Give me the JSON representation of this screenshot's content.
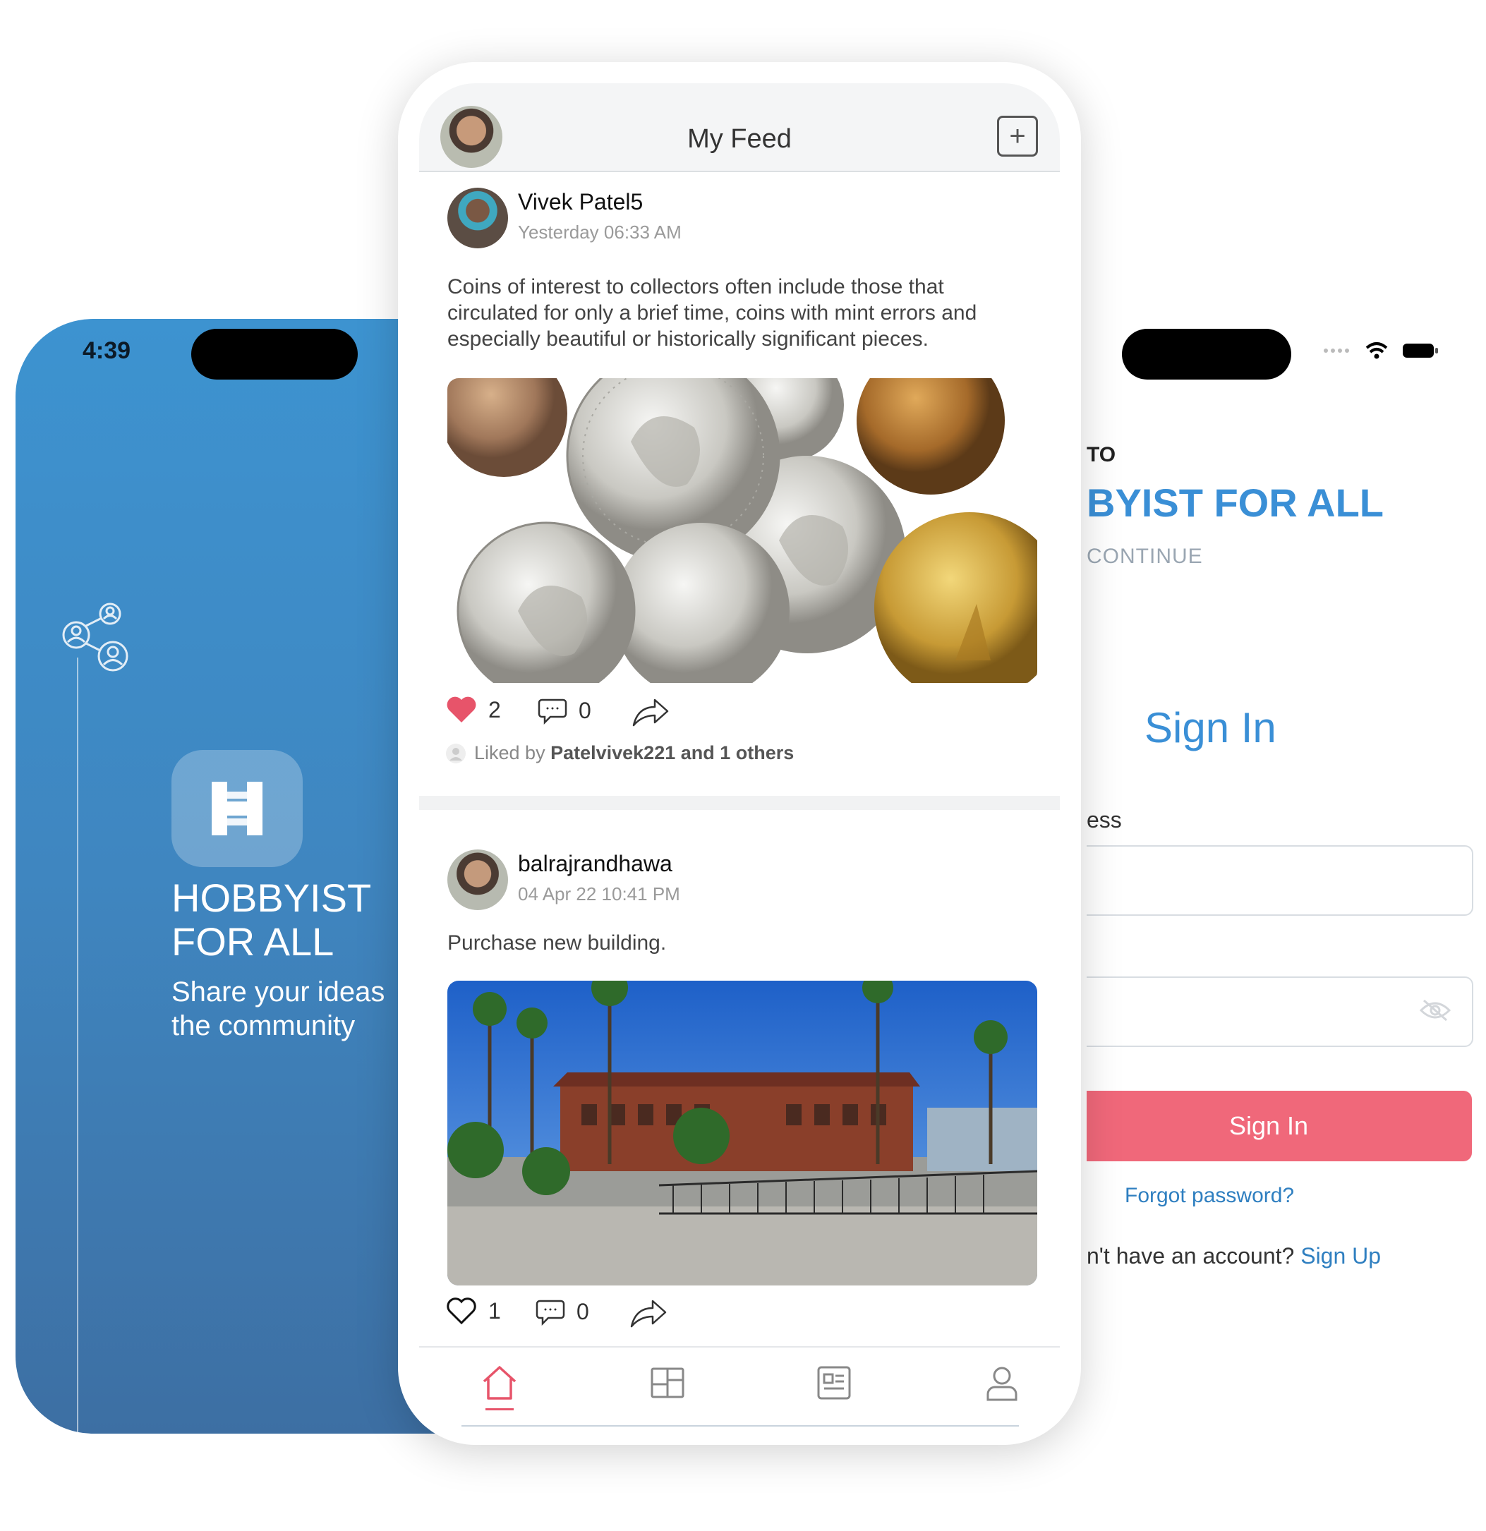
{
  "splash": {
    "status_time": "4:39",
    "app_name": "HOBBYIST\nFOR ALL",
    "tagline": "Share your ideas\nthe community"
  },
  "feed": {
    "header_title": "My Feed",
    "add_label": "+",
    "posts": [
      {
        "author": "Vivek Patel5",
        "time": "Yesterday 06:33 AM",
        "text": "Coins of interest to collectors often include those that circulated for only a brief time, coins with mint errors and especially beautiful or historically significant pieces.",
        "likes": "2",
        "comments": "0",
        "liked_by_prefix": "Liked by ",
        "liked_by_names": "Patelvivek221 and 1 others"
      },
      {
        "author": "balrajrandhawa",
        "time": "04 Apr 22 10:41 PM",
        "text": "Purchase new building.",
        "likes": "1",
        "comments": "0"
      }
    ],
    "tabs": [
      "home-icon",
      "grid-icon",
      "news-icon",
      "profile-icon"
    ]
  },
  "signin": {
    "welcome": "TO",
    "brand": "BYIST FOR ALL",
    "continue": "CONTINUE",
    "title": "Sign In",
    "email_label": "ess",
    "button": "Sign In",
    "forgot": "Forgot password?",
    "no_account": "n't have an account? ",
    "signup_link": "Sign Up"
  },
  "colors": {
    "accent_blue": "#3a8fd6",
    "button_pink": "#f0687a",
    "like_red": "#e7546a"
  }
}
